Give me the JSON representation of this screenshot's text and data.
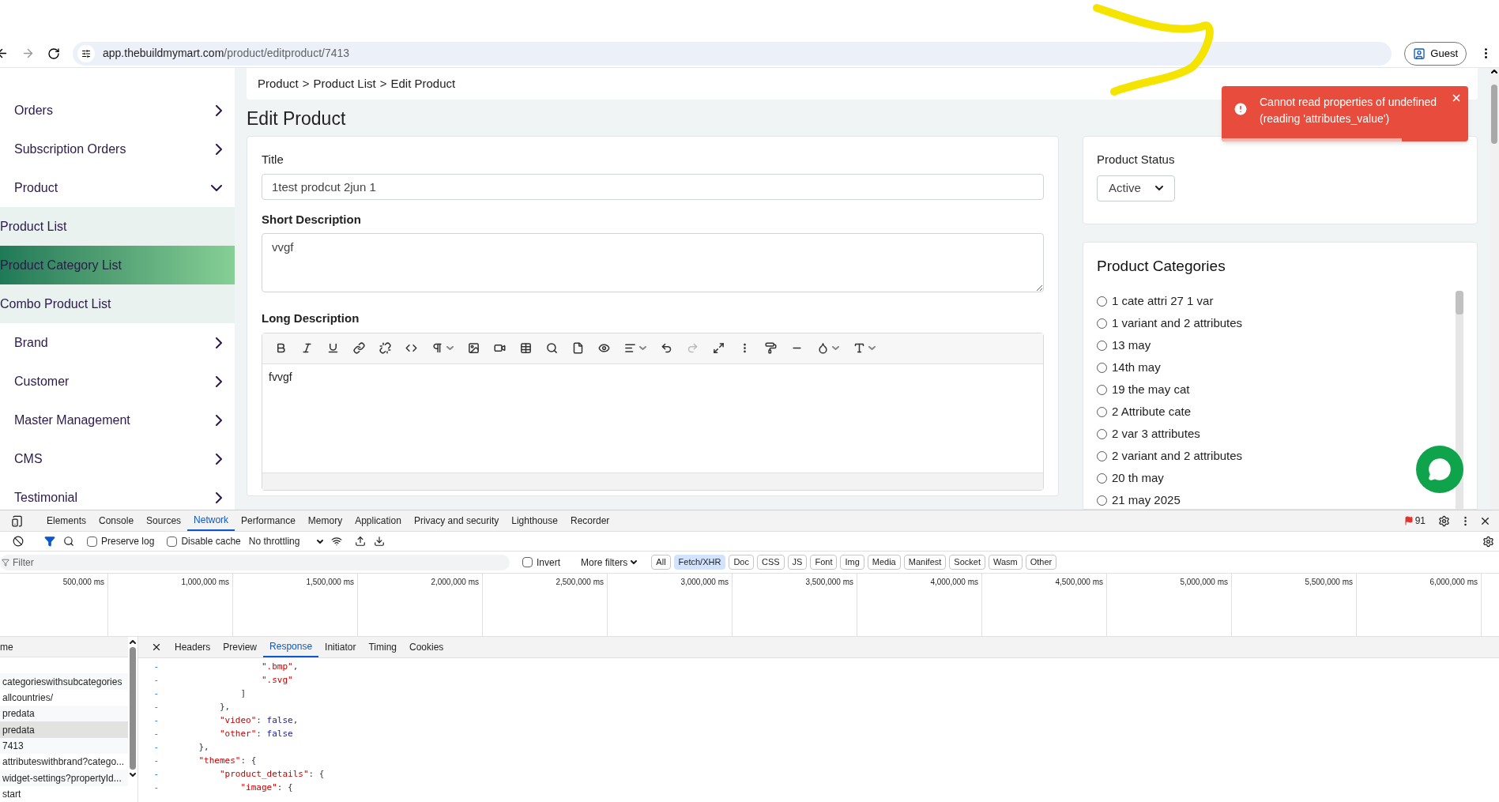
{
  "browser": {
    "url_host": "app.thebuildmymart.com",
    "url_path": "/product/editproduct/7413",
    "profile": "Guest"
  },
  "sidebar": {
    "items": [
      {
        "label": "Orders",
        "expanded": false
      },
      {
        "label": "Subscription Orders",
        "expanded": false
      },
      {
        "label": "Product",
        "expanded": true,
        "children": [
          {
            "label": "Product List",
            "selected": false
          },
          {
            "label": "Product Category List",
            "selected": true
          },
          {
            "label": "Combo Product List",
            "selected": false
          }
        ]
      },
      {
        "label": "Brand",
        "expanded": false
      },
      {
        "label": "Customer",
        "expanded": false
      },
      {
        "label": "Master Management",
        "expanded": false
      },
      {
        "label": "CMS",
        "expanded": false
      },
      {
        "label": "Testimonial",
        "expanded": false
      }
    ]
  },
  "breadcrumb": {
    "items": [
      "Product",
      "Product List",
      "Edit Product"
    ],
    "separator": ">"
  },
  "page_title": "Edit Product",
  "form": {
    "title": {
      "label": "Title",
      "value": "1test prodcut 2jun 1"
    },
    "short_description": {
      "label": "Short Description",
      "value": "vvgf"
    },
    "long_description": {
      "label": "Long Description",
      "value": "fvvgf",
      "toolbar": [
        {
          "kind": "bold"
        },
        {
          "kind": "italic"
        },
        {
          "kind": "underline"
        },
        {
          "kind": "link"
        },
        {
          "kind": "unlink"
        },
        {
          "kind": "code"
        },
        {
          "kind": "paragraph",
          "dropdown": true
        },
        {
          "kind": "image"
        },
        {
          "kind": "video"
        },
        {
          "kind": "table"
        },
        {
          "kind": "find"
        },
        {
          "kind": "file"
        },
        {
          "kind": "preview"
        },
        {
          "kind": "align",
          "dropdown": true
        },
        {
          "kind": "undo"
        },
        {
          "kind": "redo",
          "disabled": true
        },
        {
          "kind": "fullscreen"
        },
        {
          "kind": "more"
        },
        {
          "kind": "format-painter"
        },
        {
          "kind": "rule"
        },
        {
          "kind": "color",
          "dropdown": true
        },
        {
          "kind": "text-size",
          "dropdown": true
        }
      ]
    }
  },
  "status": {
    "label": "Product Status",
    "value": "Active"
  },
  "categories": {
    "title": "Product Categories",
    "items": [
      {
        "label": "1 cate attri 27 1 var",
        "selected": false
      },
      {
        "label": "1 variant and 2 attributes",
        "selected": false
      },
      {
        "label": "13 may",
        "selected": false
      },
      {
        "label": "14th may",
        "selected": false
      },
      {
        "label": "19 the may cat",
        "selected": false
      },
      {
        "label": "2 Attribute cate",
        "selected": false
      },
      {
        "label": "2 var 3 attributes",
        "selected": false
      },
      {
        "label": "2 variant and 2 attributes",
        "selected": false
      },
      {
        "label": "20 th may",
        "selected": false
      },
      {
        "label": "21 may 2025",
        "selected": false
      }
    ]
  },
  "toast": {
    "lines": [
      "Cannot read properties of undefined",
      "(reading 'attributes_value')"
    ],
    "level": 0.73
  },
  "devtools": {
    "tabs": [
      {
        "label": "Elements",
        "selected": false
      },
      {
        "label": "Console",
        "selected": false
      },
      {
        "label": "Sources",
        "selected": false
      },
      {
        "label": "Network",
        "selected": true
      },
      {
        "label": "Performance",
        "selected": false
      },
      {
        "label": "Memory",
        "selected": false
      },
      {
        "label": "Application",
        "selected": false
      },
      {
        "label": "Privacy and security",
        "selected": false
      },
      {
        "label": "Lighthouse",
        "selected": false
      },
      {
        "label": "Recorder",
        "selected": false
      }
    ],
    "issues": "91",
    "preserve_log": {
      "label": "Preserve log",
      "checked": false
    },
    "disable_cache": {
      "label": "Disable cache",
      "checked": false
    },
    "throttling": "No throttling",
    "filter_placeholder": "Filter",
    "invert": {
      "label": "Invert",
      "checked": false
    },
    "more_filters": "More filters",
    "filter_chips": [
      {
        "label": "All",
        "selected": false
      },
      {
        "label": "Fetch/XHR",
        "selected": true
      },
      {
        "label": "Doc",
        "selected": false
      },
      {
        "label": "CSS",
        "selected": false
      },
      {
        "label": "JS",
        "selected": false
      },
      {
        "label": "Font",
        "selected": false
      },
      {
        "label": "Img",
        "selected": false
      },
      {
        "label": "Media",
        "selected": false
      },
      {
        "label": "Manifest",
        "selected": false
      },
      {
        "label": "Socket",
        "selected": false
      },
      {
        "label": "Wasm",
        "selected": false
      },
      {
        "label": "Other",
        "selected": false
      }
    ],
    "timeline_ticks": [
      "500,000 ms",
      "1,000,000 ms",
      "1,500,000 ms",
      "2,000,000 ms",
      "2,500,000 ms",
      "3,000,000 ms",
      "3,500,000 ms",
      "4,000,000 ms",
      "4,500,000 ms",
      "5,000,000 ms",
      "5,500,000 ms",
      "6,000,000 ms"
    ],
    "name_header": "me",
    "requests": [
      {
        "label": "categorieswithsubcategories",
        "selected": false
      },
      {
        "label": "allcountries/",
        "selected": false
      },
      {
        "label": "predata",
        "selected": false
      },
      {
        "label": "predata",
        "selected": true
      },
      {
        "label": "7413",
        "selected": false
      },
      {
        "label": "attributeswithbrand?catego...",
        "selected": false
      },
      {
        "label": "widget-settings?propertyId...",
        "selected": false
      },
      {
        "label": "start",
        "selected": false
      }
    ],
    "detail_tabs": [
      {
        "label": "Headers",
        "selected": false
      },
      {
        "label": "Preview",
        "selected": false
      },
      {
        "label": "Response",
        "selected": true
      },
      {
        "label": "Initiator",
        "selected": false
      },
      {
        "label": "Timing",
        "selected": false
      },
      {
        "label": "Cookies",
        "selected": false
      }
    ],
    "response_lines": [
      {
        "marker": "-",
        "segments": [
          {
            "kind": "plain",
            "text": "                \""
          },
          {
            "kind": "string",
            "text": ".bmp\""
          },
          {
            "kind": "plain",
            "text": ","
          }
        ]
      },
      {
        "marker": "-",
        "segments": [
          {
            "kind": "string",
            "text": "                \".svg\""
          }
        ]
      },
      {
        "marker": "-",
        "segments": [
          {
            "kind": "plain",
            "text": "            ]"
          }
        ]
      },
      {
        "marker": "-",
        "segments": [
          {
            "kind": "plain",
            "text": "        },"
          }
        ]
      },
      {
        "marker": "-",
        "segments": [
          {
            "kind": "string",
            "text": "        \"video\""
          },
          {
            "kind": "plain",
            "text": ": "
          },
          {
            "kind": "literal",
            "text": "false"
          },
          {
            "kind": "plain",
            "text": ","
          }
        ]
      },
      {
        "marker": "-",
        "segments": [
          {
            "kind": "string",
            "text": "        \"other\""
          },
          {
            "kind": "plain",
            "text": ": "
          },
          {
            "kind": "literal",
            "text": "false"
          }
        ]
      },
      {
        "marker": "-",
        "segments": [
          {
            "kind": "plain",
            "text": "    },"
          }
        ]
      },
      {
        "marker": "-",
        "segments": [
          {
            "kind": "string",
            "text": "    \"themes\""
          },
          {
            "kind": "plain",
            "text": ": {"
          }
        ]
      },
      {
        "marker": "-",
        "segments": [
          {
            "kind": "string",
            "text": "        \"product_details\""
          },
          {
            "kind": "plain",
            "text": ": {"
          }
        ]
      },
      {
        "marker": "-",
        "segments": [
          {
            "kind": "string",
            "text": "            \"image\""
          },
          {
            "kind": "plain",
            "text": ": {"
          }
        ]
      }
    ]
  }
}
